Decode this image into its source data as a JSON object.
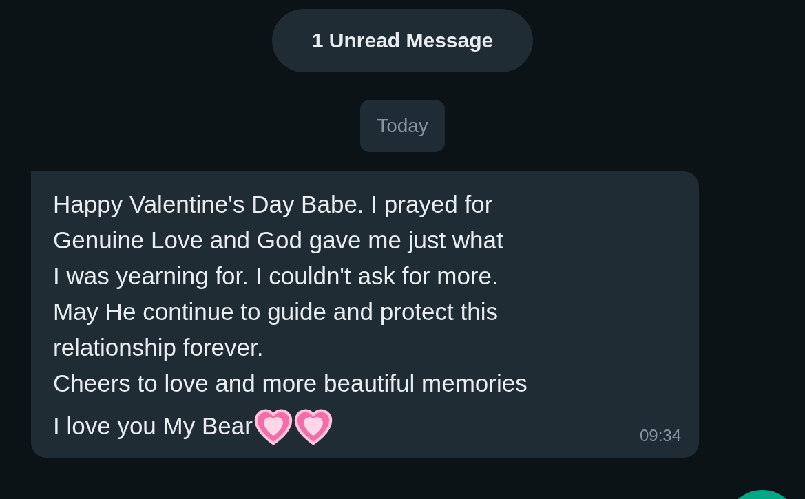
{
  "unread_banner": "1 Unread Message",
  "date_chip": "Today",
  "messages": [
    {
      "kind": "incoming",
      "text": "Happy Valentine's Day Babe. I prayed for\nGenuine Love and God gave me just what\nI was yearning for. I couldn't ask for more.\nMay He continue to guide and protect this\nrelationship forever.\nCheers to love and more beautiful memories",
      "closing": "I love you My Bear",
      "trailing_icons": [
        {
          "kind": "heart"
        },
        {
          "kind": "heart"
        }
      ],
      "time": "09:34"
    }
  ]
}
